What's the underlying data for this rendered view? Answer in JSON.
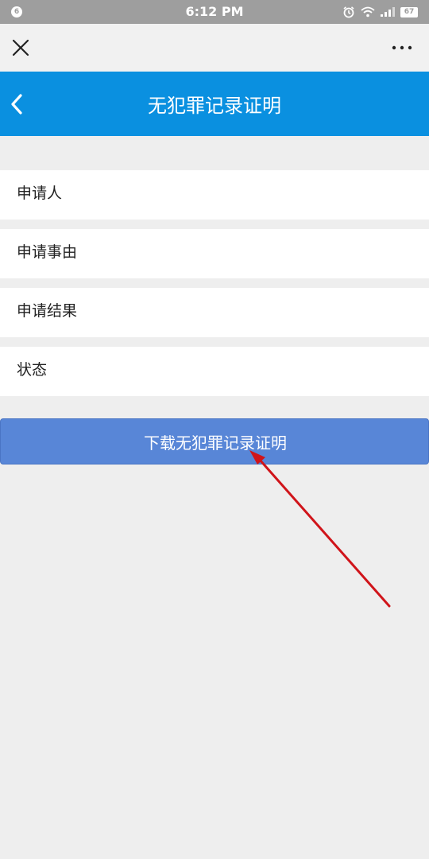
{
  "status_bar": {
    "notification_badge": "6",
    "time": "6:12 PM",
    "battery": "67",
    "icons": [
      "alarm-icon",
      "wifi-icon",
      "signal-icon",
      "battery-icon"
    ]
  },
  "webview_bar": {
    "close_icon": "close-icon",
    "more_icon": "more-icon"
  },
  "nav": {
    "title": "无犯罪记录证明",
    "back_icon": "back-arrow-icon",
    "color": "#0a90e0"
  },
  "fields": [
    {
      "label": "申请人"
    },
    {
      "label": "申请事由"
    },
    {
      "label": "申请结果"
    },
    {
      "label": "状态"
    }
  ],
  "download_button": {
    "label": "下载无犯罪记录证明",
    "color": "#5886d7"
  },
  "annotation": {
    "type": "arrow",
    "color": "#d0141a"
  }
}
